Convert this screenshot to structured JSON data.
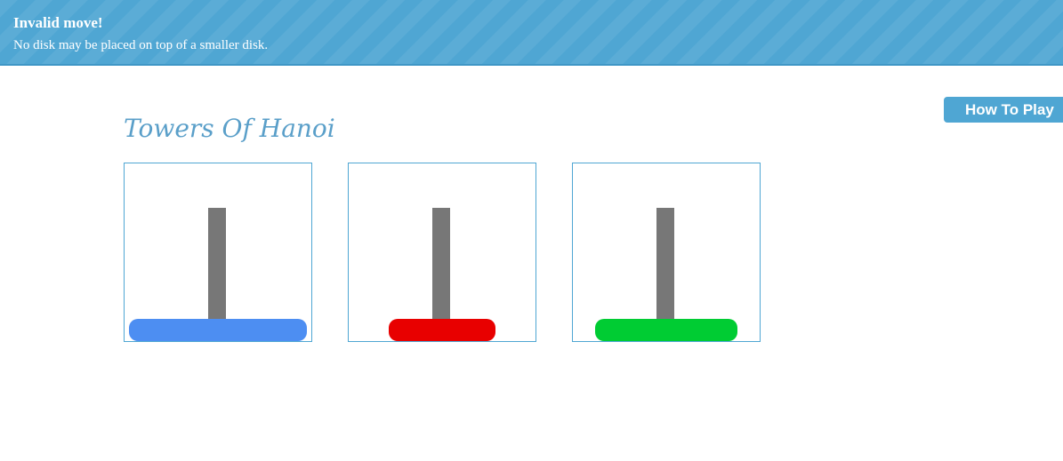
{
  "banner": {
    "title": "Invalid move!",
    "message": "No disk may be placed on top of a smaller disk.",
    "color": "#4fa6d3"
  },
  "header": {
    "how_to_play_label": "How To Play"
  },
  "game": {
    "title": "Towers Of Hanoi",
    "towers": [
      {
        "disks": [
          {
            "color": "#4d8ef2",
            "size": 3
          }
        ]
      },
      {
        "disks": [
          {
            "color": "#e80000",
            "size": 1
          }
        ]
      },
      {
        "disks": [
          {
            "color": "#00cc33",
            "size": 2
          }
        ]
      }
    ]
  }
}
